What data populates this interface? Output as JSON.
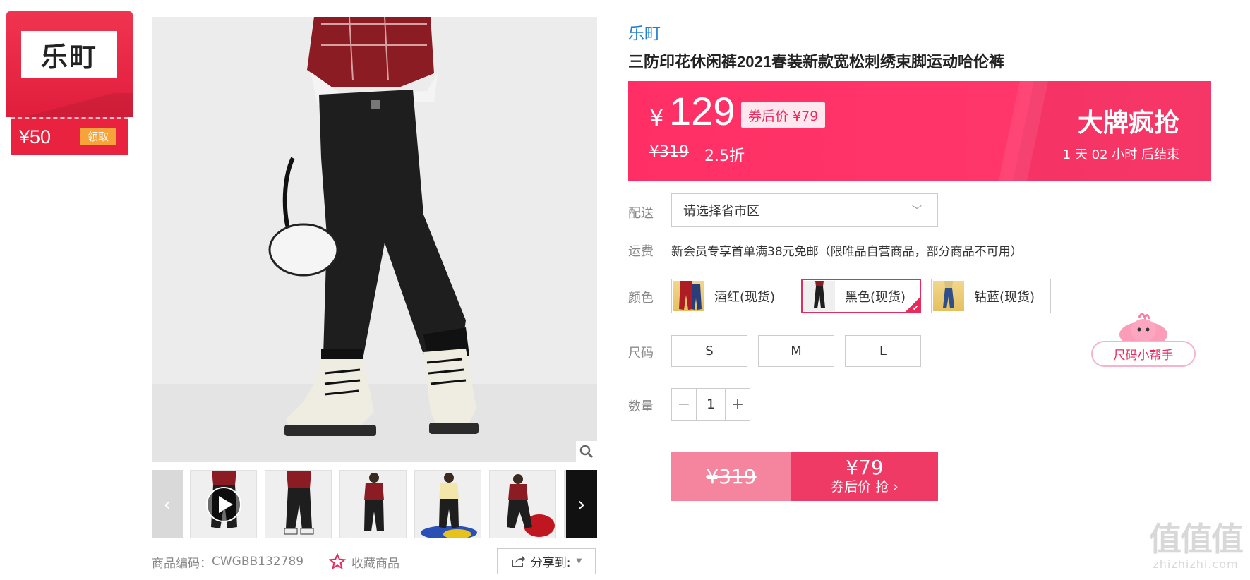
{
  "coupon_card": {
    "logo_text": "乐町",
    "amount": "¥50",
    "claim_label": "领取"
  },
  "gallery": {
    "main_image": "black-jogger-pants-photo",
    "zoom_icon": "magnifier-icon",
    "prev_icon": "chevron-left-icon",
    "next_icon": "chevron-right-icon",
    "thumbnails": [
      {
        "name": "video-thumbnail",
        "has_play": true
      },
      {
        "name": "thumbnail-2"
      },
      {
        "name": "thumbnail-3"
      },
      {
        "name": "thumbnail-4"
      },
      {
        "name": "thumbnail-5"
      },
      {
        "name": "thumbnail-6"
      }
    ]
  },
  "meta": {
    "sku_label": "商品编码：",
    "sku": "CWGBB132789",
    "favorite_label": "收藏商品",
    "share_label": "分享到:"
  },
  "product": {
    "brand": "乐町",
    "title": "三防印花休闲裤2021春装新款宽松刺绣束脚运动哈伦裤"
  },
  "price_banner": {
    "currency": "¥",
    "price": "129",
    "after_coupon": "券后价 ¥79",
    "original": "¥319",
    "discount": "2.5折",
    "promo_title": "大牌疯抢",
    "countdown": "1  天 02 小时 后结束"
  },
  "options": {
    "delivery_label": "配送",
    "region_placeholder": "请选择省市区",
    "shipping_label": "运费",
    "shipping_text": "新会员专享首单满38元免邮（限唯品自营商品，部分商品不可用）",
    "color_label": "颜色",
    "colors": [
      {
        "label": "酒红(现货)",
        "selected": false
      },
      {
        "label": "黑色(现货)",
        "selected": true
      },
      {
        "label": "钴蓝(现货)",
        "selected": false
      }
    ],
    "size_label": "尺码",
    "sizes": [
      "S",
      "M",
      "L"
    ],
    "qty_label": "数量",
    "qty_minus": "−",
    "qty_value": "1",
    "qty_plus": "+"
  },
  "buy": {
    "original": "¥319",
    "price": "¥79",
    "label": "券后价 抢 ›"
  },
  "size_helper": {
    "label": "尺码小帮手"
  },
  "watermark": {
    "mark": "值值值",
    "site": "zhizhizhi.com"
  },
  "colors": {
    "accent": "#ff2f65",
    "brand_link": "#1f7fd4",
    "coupon_red": "#e8223f",
    "claim_orange": "#f6a43a"
  }
}
